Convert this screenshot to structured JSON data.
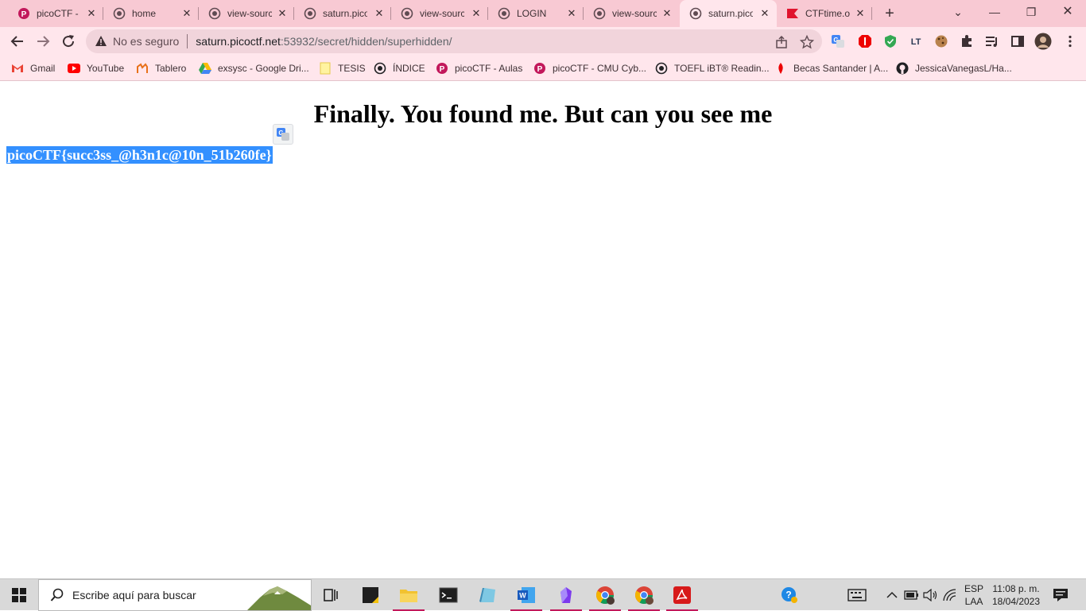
{
  "browser": {
    "tabs": [
      {
        "title": "picoCTF - picoGym",
        "icon": "picoctf-icon"
      },
      {
        "title": "home",
        "icon": "globe-icon"
      },
      {
        "title": "view-source",
        "icon": "globe-icon"
      },
      {
        "title": "saturn.picoctf",
        "icon": "globe-icon"
      },
      {
        "title": "view-source",
        "icon": "globe-icon"
      },
      {
        "title": "LOGIN",
        "icon": "globe-icon"
      },
      {
        "title": "view-source",
        "icon": "globe-icon"
      },
      {
        "title": "saturn.picoctf",
        "icon": "globe-icon",
        "active": true
      },
      {
        "title": "CTFtime.org",
        "icon": "ctftime-icon"
      }
    ],
    "new_tab_label": "+",
    "address_bar": {
      "security_label": "No es seguro",
      "host": "saturn.picoctf.net",
      "path": ":53932/secret/hidden/superhidden/"
    },
    "bookmarks": [
      {
        "label": "Gmail",
        "icon": "gmail-icon"
      },
      {
        "label": "YouTube",
        "icon": "youtube-icon"
      },
      {
        "label": "Tablero",
        "icon": "tablero-icon"
      },
      {
        "label": "exsysc - Google Dri...",
        "icon": "google-drive-icon"
      },
      {
        "label": "TESIS",
        "icon": "folder-icon"
      },
      {
        "label": "ÍNDICE",
        "icon": "globe-icon"
      },
      {
        "label": "picoCTF - Aulas",
        "icon": "picoctf-icon"
      },
      {
        "label": "picoCTF - CMU Cyb...",
        "icon": "picoctf-icon"
      },
      {
        "label": "TOEFL iBT® Readin...",
        "icon": "globe-icon"
      },
      {
        "label": "Becas Santander | A...",
        "icon": "santander-icon"
      },
      {
        "label": "JessicaVanegasL/Ha...",
        "icon": "github-icon"
      }
    ]
  },
  "page": {
    "heading": "Finally. You found me. But can you see me",
    "flag": "picoCTF{succ3ss_@h3n1c@10n_51b260fe}"
  },
  "taskbar": {
    "search_placeholder": "Escribe aquí para buscar",
    "language_line1": "ESP",
    "language_line2": "LAA",
    "time": "11:08 p. m.",
    "date": "18/04/2023"
  },
  "colors": {
    "tabstrip": "#f8c9d3",
    "toolbar": "#ffe6ec",
    "selection": "#3390ff"
  }
}
